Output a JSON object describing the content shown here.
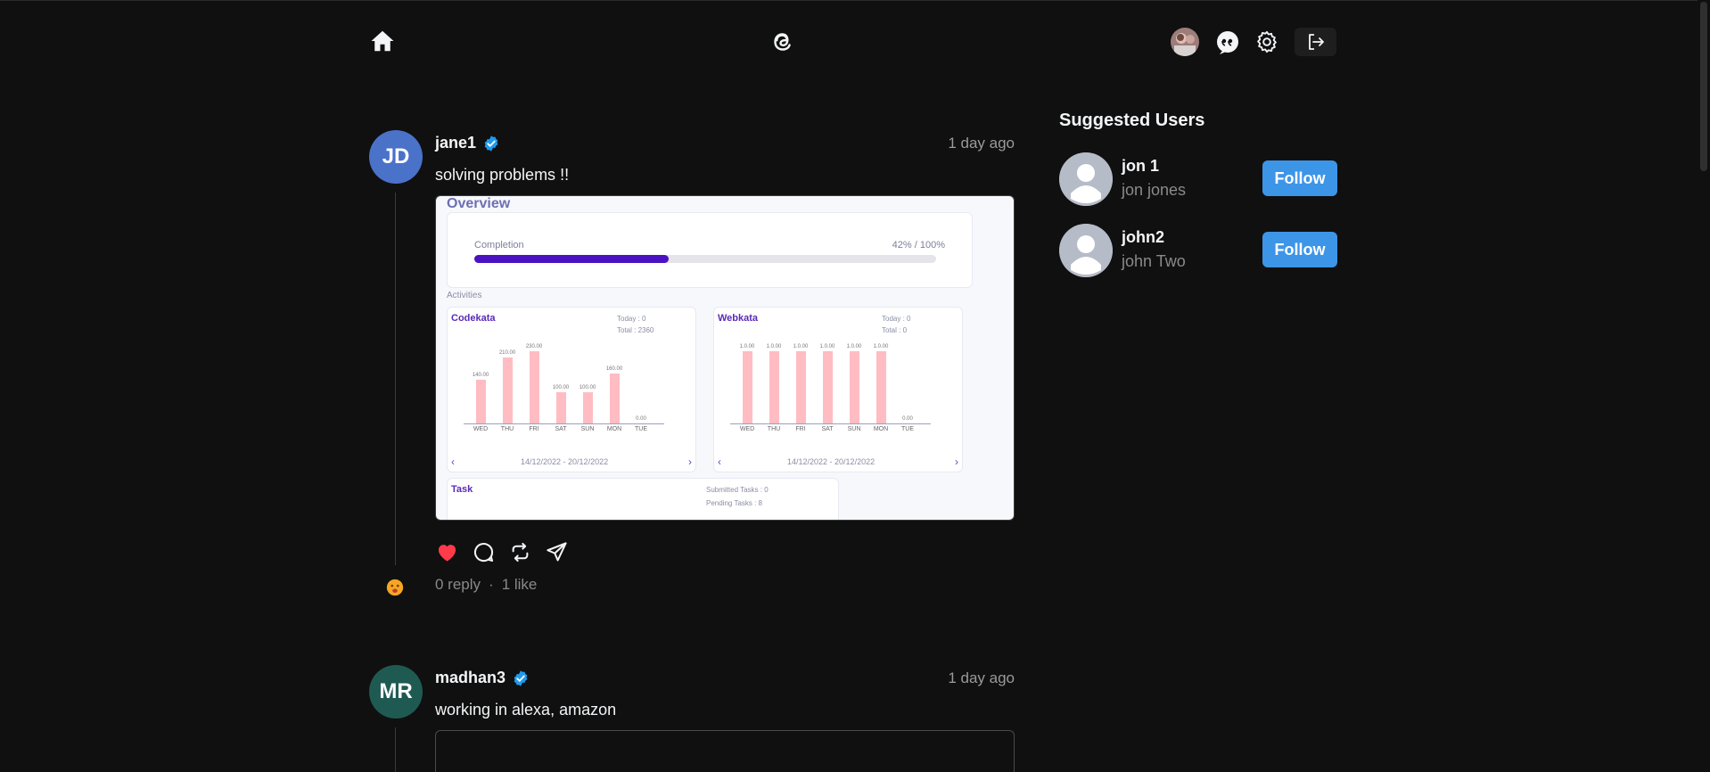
{
  "sidebar": {
    "title": "Suggested Users",
    "users": [
      {
        "username": "jon 1",
        "name": "jon jones",
        "follow_label": "Follow"
      },
      {
        "username": "john2",
        "name": "john Two",
        "follow_label": "Follow"
      }
    ]
  },
  "posts": [
    {
      "initials": "JD",
      "avatar_color": "#4a72c9",
      "username": "jane1",
      "time": "1 day ago",
      "text": "solving problems !!",
      "replies": "0 reply",
      "dot": "·",
      "likes": "1 like",
      "image": {
        "title": "Overview",
        "completion_label": "Completion",
        "completion_value": "42% / 100%",
        "completion_fraction": 0.42,
        "activities_label": "Activities",
        "codekata": {
          "title": "Codekata",
          "today": "Today : 0",
          "total": "Total : 2360",
          "days": [
            "WED",
            "THU",
            "FRI",
            "SAT",
            "SUN",
            "MON",
            "TUE"
          ],
          "values": [
            140,
            210,
            230,
            100,
            100,
            160,
            0
          ],
          "value_labels": [
            "140.00",
            "210.00",
            "230.00",
            "100.00",
            "100.00",
            "160.00",
            "0.00"
          ],
          "range": "14/12/2022 - 20/12/2022"
        },
        "webkata": {
          "title": "Webkata",
          "today": "Today : 0",
          "total": "Total : 0",
          "days": [
            "WED",
            "THU",
            "FRI",
            "SAT",
            "SUN",
            "MON",
            "TUE"
          ],
          "values": [
            1,
            1,
            1,
            1,
            1,
            1,
            0
          ],
          "value_labels": [
            "1.0.00",
            "1.0.00",
            "1.0.00",
            "1.0.00",
            "1.0.00",
            "1.0.00",
            "0.00"
          ],
          "range": "14/12/2022 - 20/12/2022"
        },
        "task": {
          "title": "Task",
          "submitted": "Submitted Tasks : 0",
          "pending": "Pending Tasks : 8"
        }
      }
    },
    {
      "initials": "MR",
      "avatar_color": "#1f5a52",
      "username": "madhan3",
      "time": "1 day ago",
      "text": "working in alexa, amazon"
    }
  ],
  "colors": {
    "background": "#101010",
    "like_red": "#ff3b4a",
    "follow_blue": "#3d95e8",
    "verified_blue": "#1d9bf0"
  },
  "icons": [
    "home-icon",
    "threads-logo-icon",
    "chat-icon",
    "settings-icon",
    "logout-icon",
    "heart-icon",
    "comment-icon",
    "repost-icon",
    "share-icon",
    "verified-icon",
    "user-silhouette-icon"
  ]
}
